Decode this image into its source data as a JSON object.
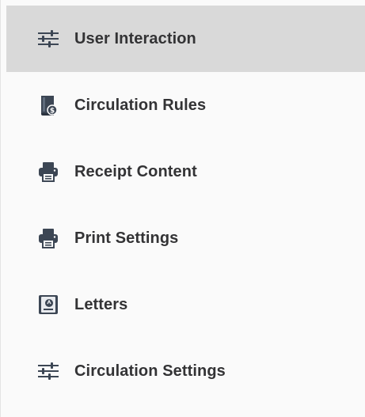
{
  "sidebar": {
    "active_index": 0,
    "items": [
      {
        "label": "User Interaction",
        "icon": "sliders-icon",
        "active": true
      },
      {
        "label": "Circulation Rules",
        "icon": "rules-book-icon",
        "active": false
      },
      {
        "label": "Receipt Content",
        "icon": "printer-icon",
        "active": false
      },
      {
        "label": "Print Settings",
        "icon": "printer-icon",
        "active": false
      },
      {
        "label": "Letters",
        "icon": "letter-icon",
        "active": false
      },
      {
        "label": "Circulation Settings",
        "icon": "sliders-icon",
        "active": false
      }
    ]
  },
  "colors": {
    "active_background": "#d9d9d9",
    "text": "#333335",
    "icon": "#3c4654"
  }
}
